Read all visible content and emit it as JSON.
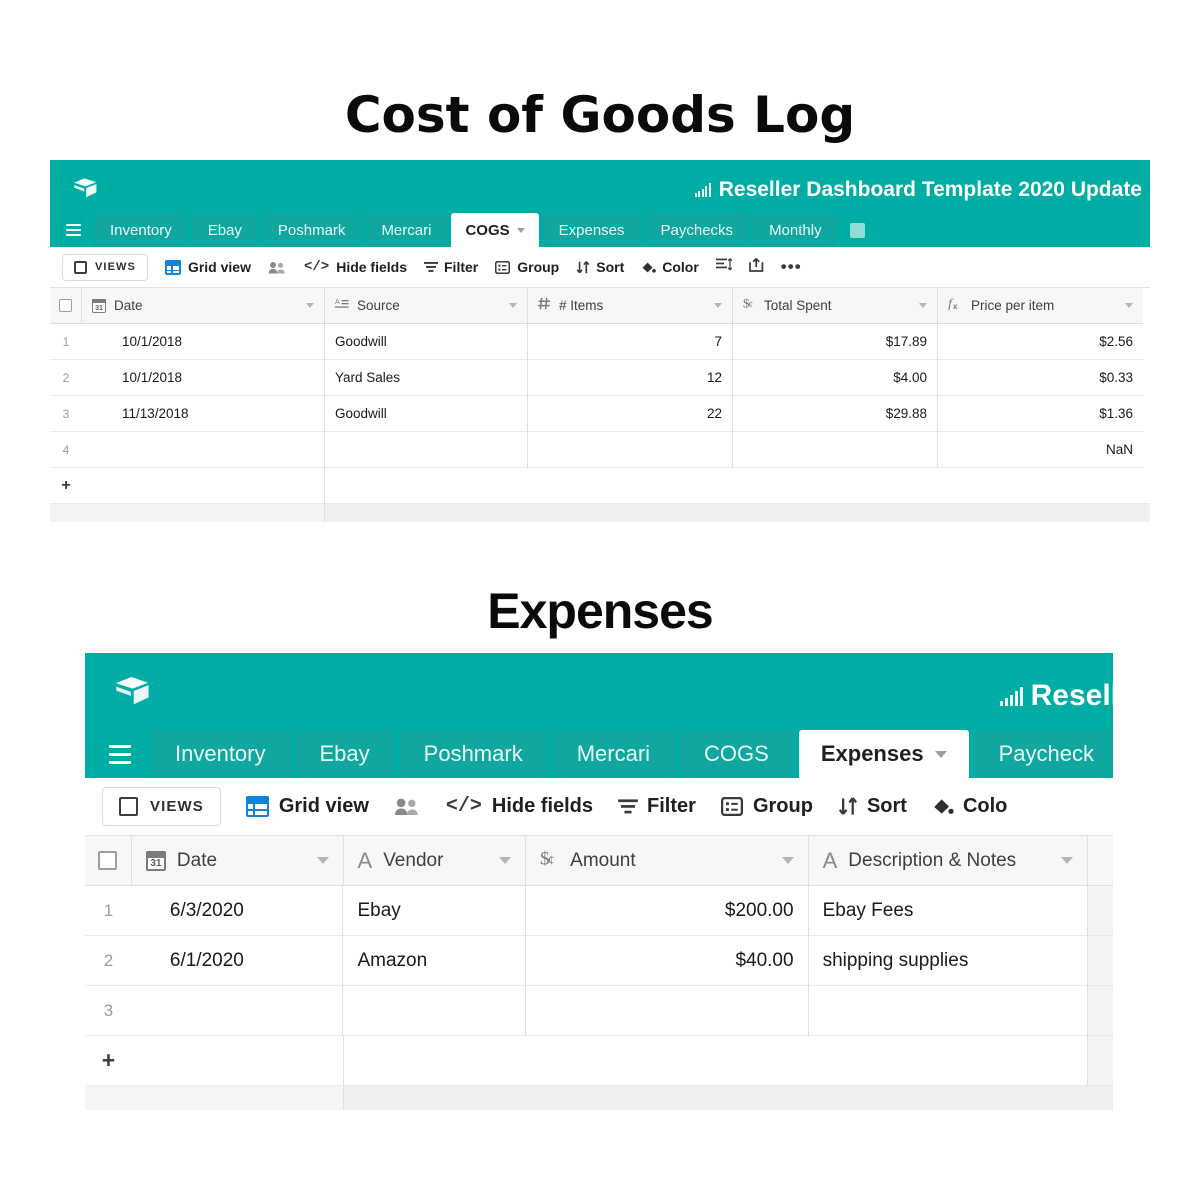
{
  "sections": {
    "cogs_title": "Cost of Goods Log",
    "expenses_title": "Expenses"
  },
  "colors": {
    "teal": "#00ADA5",
    "tab_teal": "#0FA79F",
    "grid_blue": "#1283da"
  },
  "cogs_app": {
    "base_name": "Reseller Dashboard Template 2020 Update",
    "logo_icon": "airtable-cube-icon",
    "base_icon": "bar-chart-icon",
    "menu_icon": "hamburger-menu-icon",
    "tabs": [
      {
        "label": "Inventory",
        "active": false
      },
      {
        "label": "Ebay",
        "active": false
      },
      {
        "label": "Poshmark",
        "active": false
      },
      {
        "label": "Mercari",
        "active": false
      },
      {
        "label": "COGS",
        "active": true
      },
      {
        "label": "Expenses",
        "active": false
      },
      {
        "label": "Paychecks",
        "active": false
      },
      {
        "label": "Monthly",
        "active": false
      }
    ],
    "add_tab_icon": "add-table-icon",
    "toolbar": {
      "views_label": "VIEWS",
      "views_icon": "sidebar-panel-icon",
      "grid_view_label": "Grid view",
      "grid_view_icon": "grid-view-icon",
      "collaborators_icon": "collaborators-icon",
      "hide_fields_label": "Hide fields",
      "hide_fields_icon": "hide-fields-icon",
      "filter_label": "Filter",
      "filter_icon": "filter-icon",
      "group_label": "Group",
      "group_icon": "group-icon",
      "sort_label": "Sort",
      "sort_icon": "sort-icon",
      "color_label": "Color",
      "color_icon": "paint-bucket-icon",
      "row_height_icon": "row-height-icon",
      "share_icon": "share-export-icon",
      "more_icon": "more-options-icon"
    },
    "table": {
      "columns": [
        {
          "name": "Date",
          "icon": "calendar-icon",
          "align": "left"
        },
        {
          "name": "Source",
          "icon": "long-text-icon",
          "align": "left"
        },
        {
          "name": "# Items",
          "icon": "number-icon",
          "align": "right"
        },
        {
          "name": "Total Spent",
          "icon": "currency-icon",
          "align": "right"
        },
        {
          "name": "Price per item",
          "icon": "formula-icon",
          "align": "right"
        }
      ],
      "rows": [
        {
          "num": "1",
          "Date": "10/1/2018",
          "Source": "Goodwill",
          "# Items": "7",
          "Total Spent": "$17.89",
          "Price per item": "$2.56"
        },
        {
          "num": "2",
          "Date": "10/1/2018",
          "Source": "Yard Sales",
          "# Items": "12",
          "Total Spent": "$4.00",
          "Price per item": "$0.33"
        },
        {
          "num": "3",
          "Date": "11/13/2018",
          "Source": "Goodwill",
          "# Items": "22",
          "Total Spent": "$29.88",
          "Price per item": "$1.36"
        },
        {
          "num": "4",
          "Date": "",
          "Source": "",
          "# Items": "",
          "Total Spent": "",
          "Price per item": "NaN"
        }
      ],
      "add_row_label": "+"
    }
  },
  "expenses_app": {
    "base_name": "Resell",
    "logo_icon": "airtable-cube-icon",
    "base_icon": "bar-chart-icon",
    "menu_icon": "hamburger-menu-icon",
    "tabs": [
      {
        "label": "Inventory",
        "active": false
      },
      {
        "label": "Ebay",
        "active": false
      },
      {
        "label": "Poshmark",
        "active": false
      },
      {
        "label": "Mercari",
        "active": false
      },
      {
        "label": "COGS",
        "active": false
      },
      {
        "label": "Expenses",
        "active": true
      },
      {
        "label": "Paycheck",
        "active": false
      }
    ],
    "toolbar": {
      "views_label": "VIEWS",
      "views_icon": "sidebar-panel-icon",
      "grid_view_label": "Grid view",
      "grid_view_icon": "grid-view-icon",
      "collaborators_icon": "collaborators-icon",
      "hide_fields_label": "Hide fields",
      "hide_fields_icon": "hide-fields-icon",
      "filter_label": "Filter",
      "filter_icon": "filter-icon",
      "group_label": "Group",
      "group_icon": "group-icon",
      "sort_label": "Sort",
      "sort_icon": "sort-icon",
      "color_label": "Colo",
      "color_icon": "paint-bucket-icon"
    },
    "table": {
      "columns": [
        {
          "name": "Date",
          "icon": "calendar-icon",
          "align": "left"
        },
        {
          "name": "Vendor",
          "icon": "text-icon",
          "align": "left"
        },
        {
          "name": "Amount",
          "icon": "currency-icon",
          "align": "right"
        },
        {
          "name": "Description & Notes",
          "icon": "text-icon",
          "align": "left"
        }
      ],
      "rows": [
        {
          "num": "1",
          "Date": "6/3/2020",
          "Vendor": "Ebay",
          "Amount": "$200.00",
          "Description & Notes": "Ebay Fees"
        },
        {
          "num": "2",
          "Date": "6/1/2020",
          "Vendor": "Amazon",
          "Amount": "$40.00",
          "Description & Notes": "shipping supplies"
        },
        {
          "num": "3",
          "Date": "",
          "Vendor": "",
          "Amount": "",
          "Description & Notes": ""
        }
      ],
      "add_row_label": "+"
    }
  }
}
